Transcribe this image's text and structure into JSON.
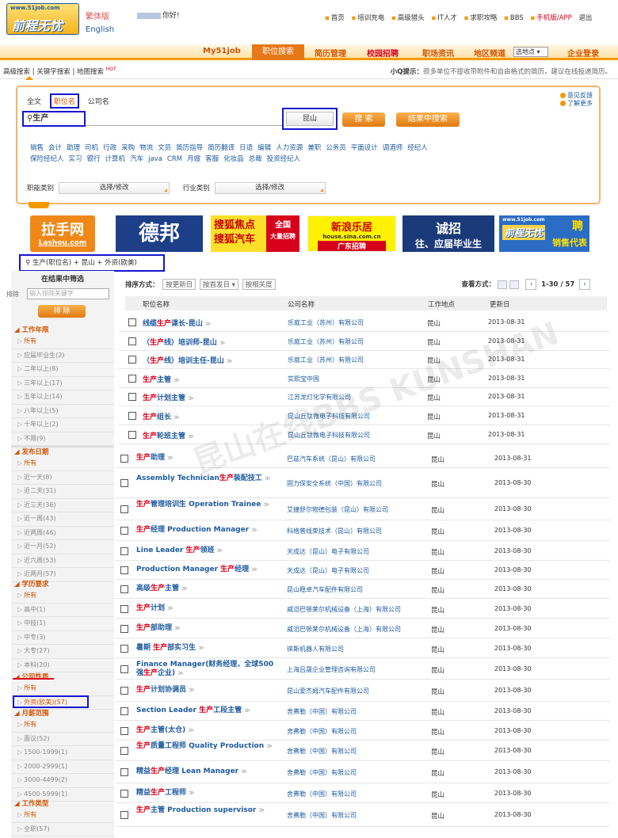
{
  "header": {
    "url": "www.51job.com",
    "brand": "前程无忧",
    "lang_tw": "繁体版",
    "lang_en": "English",
    "greeting": "你好!",
    "links": [
      "首页",
      "培训充电",
      "高级猎头",
      "IT人才",
      "求职攻略",
      "BBS"
    ],
    "mobile": "手机版/APP",
    "logout": "退出"
  },
  "nav": {
    "my": "My51job",
    "items": [
      "职位搜索",
      "简历管理",
      "校园招聘",
      "职场资讯",
      "地区频道"
    ],
    "city_select": "选地点",
    "enterprise": "企业登录"
  },
  "subnav": {
    "left": "高级搜索 | 关键字搜索 | 地图搜索",
    "hot": "HOT",
    "tip_label": "小Q提示：",
    "tip": "很多单位不接收带附件和自由格式的简历，建议在线投递简历。"
  },
  "search": {
    "tabs": [
      "全文",
      "职位名",
      "公司名"
    ],
    "keyword": "生产",
    "location": "昆山",
    "search_btn": "搜  索",
    "within_btn": "结果中搜索",
    "feedback": "意见反馈",
    "more": "了解更多",
    "words": [
      "销售",
      "会计",
      "助理",
      "司机",
      "行政",
      "采购",
      "物流",
      "文员",
      "简历指导",
      "简历翻译",
      "日语",
      "编辑",
      "人力资源",
      "兼职",
      "公务员",
      "平面设计",
      "调酒师",
      "经纪人",
      "保险经纪人",
      "实习",
      "银行",
      "计算机",
      "汽车",
      "java",
      "CRM",
      "月嫂",
      "客服",
      "化妆品",
      "总裁",
      "投资经纪人"
    ],
    "func_label": "职能类别",
    "func_btn": "选择/修改",
    "ind_label": "行业类别",
    "ind_btn": "选择/修改"
  },
  "ads": [
    "拉手网",
    "Lashou.com",
    "德邦",
    "搜狐焦点",
    "搜狐汽车",
    "全国",
    "大量招聘",
    "新浪乐居",
    "house.sina.com.cn",
    "广东招聘",
    "诚招",
    "往、应届毕业生",
    "www.51job.com",
    "前程无忧",
    "聘",
    "销售代表"
  ],
  "crumb": "生产(职位名) + 昆山 + 外资(欧美)",
  "sidebar": {
    "title": "在结果中筛选",
    "exclude": "排除",
    "exclude_placeholder": "输入排除关键字",
    "exclude_btn": "排  除",
    "groups": [
      {
        "name": "工作年限",
        "items": [
          "所有",
          "应届毕业生(2)",
          "二年以上(8)",
          "三年以上(17)",
          "五年以上(14)",
          "八年以上(5)",
          "十年以上(2)",
          "不限(9)"
        ]
      },
      {
        "name": "发布日期",
        "items": [
          "所有",
          "近一天(8)",
          "近二天(31)",
          "近三天(36)",
          "近一周(43)",
          "近两周(46)",
          "近一月(52)",
          "近六周(53)",
          "近两月(57)"
        ]
      },
      {
        "name": "学历要求",
        "items": [
          "所有",
          "高中(1)",
          "中技(1)",
          "中专(3)",
          "大专(27)",
          "本科(20)"
        ]
      },
      {
        "name": "公司性质",
        "items": [
          "所有",
          "外资(欧美)(57)"
        ]
      },
      {
        "name": "月薪范围",
        "items": [
          "所有",
          "面议(52)",
          "1500-1999(1)",
          "2000-2999(1)",
          "3000-4499(2)",
          "4500-5999(1)"
        ]
      },
      {
        "name": "工作类型",
        "items": [
          "所有",
          "全职(57)"
        ]
      }
    ]
  },
  "results": {
    "sort_label": "排序方式：",
    "sort": [
      "按更新日",
      "按首发日",
      "按相关度"
    ],
    "view_label": "查看方式：",
    "page": "1-30 / 57",
    "cols": [
      "职位名称",
      "公司名称",
      "工作地点",
      "更新日"
    ],
    "rows": [
      [
        "线缆生产课长-昆山",
        "乐庭工业（苏州）有限公司",
        "昆山",
        "2013-08-31"
      ],
      [
        "（生产线）培训师-昆山",
        "乐庭工业（苏州）有限公司",
        "昆山",
        "2013-08-31"
      ],
      [
        "（生产线）培训主任-昆山",
        "乐庭工业（苏州）有限公司",
        "昆山",
        "2013-08-31"
      ],
      [
        "生产主管",
        "实熙宝中国",
        "昆山",
        "2013-08-31"
      ],
      [
        "生产计划主管",
        "江苏龙灯化学有限公司",
        "昆山",
        "2013-08-31"
      ],
      [
        "生产组长",
        "昆山丘钛微电子科技有限公司",
        "昆山",
        "2013-08-31"
      ],
      [
        "生产轮班主管",
        "昆山丘钛微电子科技有限公司",
        "昆山",
        "2013-08-31"
      ],
      [
        "生产助理",
        "巴兹汽车系统（昆山）有限公司",
        "昆山",
        "2013-08-31"
      ],
      [
        "Assembly Technician生产装配技工",
        "固力保安全系统（中国）有限公司",
        "昆山",
        "2013-08-30"
      ],
      [
        "生产管理培训生 Operation Trainee",
        "艾捷舒尔物德包装（昆山）有限公司",
        "昆山",
        "2013-08-30"
      ],
      [
        "生产经理 Production Manager",
        "科络普线束技术（昆山）有限公司",
        "昆山",
        "2013-08-30"
      ],
      [
        "Line Leader 生产领班",
        "天成达（昆山）电子有限公司",
        "昆山",
        "2013-08-30"
      ],
      [
        "Production Manager 生产经理",
        "天成达（昆山）电子有限公司",
        "昆山",
        "2013-08-30"
      ],
      [
        "高级生产主管",
        "昆山稳卓汽车配件有限公司",
        "昆山",
        "2013-08-30"
      ],
      [
        "生产计划",
        "威滔巴顿莱尔机械设备（上海）有限公司",
        "昆山",
        "2013-08-30"
      ],
      [
        "生产部助理",
        "威滔巴顿莱尔机械设备（上海）有限公司",
        "昆山",
        "2013-08-30"
      ],
      [
        "暑期 生产部实习生",
        "徕斯机器人有限公司",
        "昆山",
        "2013-08-30"
      ],
      [
        "Finance Manager(财务经理，全球500强生产企业)",
        "上海吕晟企业管理咨询有限公司",
        "昆山",
        "2013-08-30"
      ],
      [
        "生产计划协调员",
        "昆山爱杰姆汽车配件有限公司",
        "昆山",
        "2013-08-30"
      ],
      [
        "Section Leader 生产工段主管",
        "舍弗勒（中国）有限公司",
        "昆山",
        "2013-08-30"
      ],
      [
        "生产主管(太仓)",
        "舍弗勒（中国）有限公司",
        "昆山",
        "2013-08-30"
      ],
      [
        "生产质量工程师 Quality Production",
        "舍弗勒（中国）有限公司",
        "昆山",
        "2013-08-30"
      ],
      [
        "精益生产经理 Lean Manager",
        "舍弗勒（中国）有限公司",
        "昆山",
        "2013-08-30"
      ],
      [
        "精益生产工程师",
        "舍弗勒（中国）有限公司",
        "昆山",
        "2013-08-30"
      ],
      [
        "生产主管 Production supervisor",
        "舍弗勒（中国）有限公司",
        "昆山",
        "2013-08-30"
      ]
    ]
  },
  "watermark": "昆山在线BBS KUNSHAN"
}
